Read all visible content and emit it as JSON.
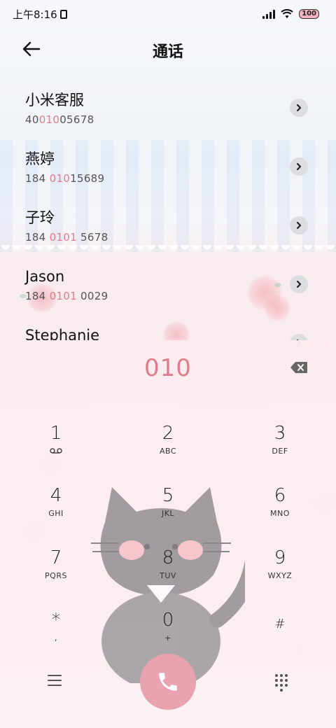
{
  "status_bar": {
    "time": "上午8:16",
    "battery": "100"
  },
  "header": {
    "title": "通话"
  },
  "contacts": [
    {
      "name": "小米客服",
      "number_pre": "40",
      "number_hl": "010",
      "number_post": "05678"
    },
    {
      "name": "燕婷",
      "number_pre": "184 ",
      "number_hl": "010",
      "number_post": "15689"
    },
    {
      "name": "子玲",
      "number_pre": "184 ",
      "number_hl": "0101",
      "number_post": " 5678"
    },
    {
      "name": "Jason",
      "number_pre": "184 ",
      "number_hl": "0101",
      "number_post": " 0029"
    },
    {
      "name": "Stephanie",
      "number_pre": "",
      "number_hl": "",
      "number_post": ""
    }
  ],
  "dialpad": {
    "input": "010",
    "keys": [
      {
        "digit": "1",
        "sub": ""
      },
      {
        "digit": "2",
        "sub": "ABC"
      },
      {
        "digit": "3",
        "sub": "DEF"
      },
      {
        "digit": "4",
        "sub": "GHI"
      },
      {
        "digit": "5",
        "sub": "JKL"
      },
      {
        "digit": "6",
        "sub": "MNO"
      },
      {
        "digit": "7",
        "sub": "PQRS"
      },
      {
        "digit": "8",
        "sub": "TUV"
      },
      {
        "digit": "9",
        "sub": "WXYZ"
      },
      {
        "digit": "*",
        "sub": ","
      },
      {
        "digit": "0",
        "sub": "+"
      },
      {
        "digit": "#",
        "sub": ""
      }
    ]
  },
  "colors": {
    "accent": "#e07c8c",
    "call_button": "#e9a3b0"
  }
}
